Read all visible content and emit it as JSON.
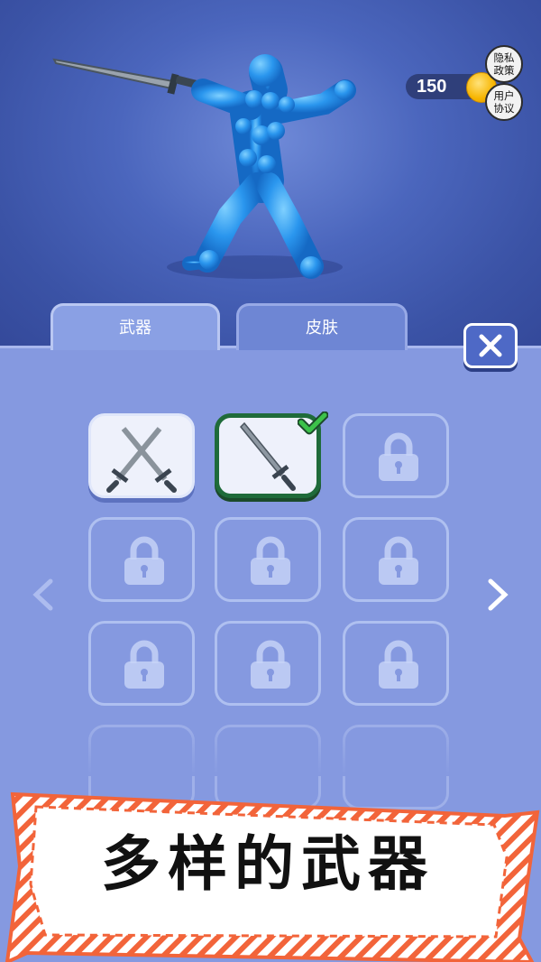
{
  "hud": {
    "coin_count": "150",
    "privacy_label": "隐私政策",
    "user_agreement_label": "用户协议"
  },
  "tabs": [
    {
      "label": "武器",
      "active": true
    },
    {
      "label": "皮肤",
      "active": false
    }
  ],
  "grid": {
    "slots": [
      {
        "icon": "crossed-swords-icon",
        "state": "unlocked"
      },
      {
        "icon": "sword-icon",
        "state": "selected"
      },
      {
        "icon": "lock-icon",
        "state": "locked"
      },
      {
        "icon": "lock-icon",
        "state": "locked"
      },
      {
        "icon": "lock-icon",
        "state": "locked"
      },
      {
        "icon": "lock-icon",
        "state": "locked"
      },
      {
        "icon": "lock-icon",
        "state": "locked"
      },
      {
        "icon": "lock-icon",
        "state": "locked"
      },
      {
        "icon": "lock-icon",
        "state": "locked"
      }
    ]
  },
  "banner": {
    "text": "多样的武器"
  },
  "colors": {
    "panel": "#8599e0",
    "selected_border": "#1f6b3a",
    "check": "#3cc24a",
    "coin": "#f7b500",
    "banner_stripe": "#f2643a"
  }
}
